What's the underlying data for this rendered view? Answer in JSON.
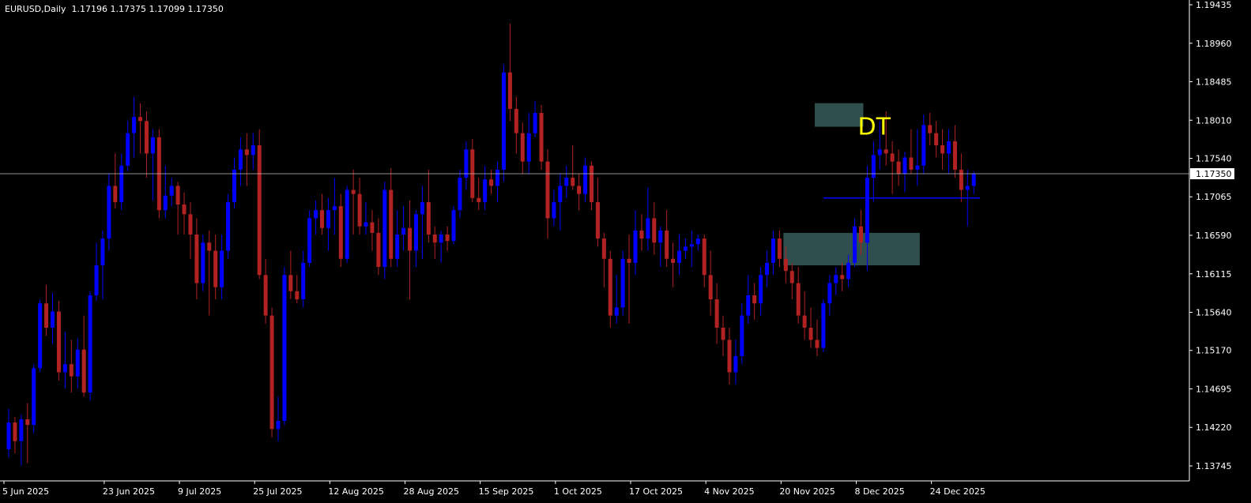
{
  "chart_header": {
    "symbol": "EURUSD,Daily",
    "ohlc": "1.17196 1.17375 1.17099 1.17350"
  },
  "colors": {
    "background": "#000000",
    "axis": "#ffffff",
    "bull": "#0000ff",
    "bear": "#b22222",
    "zone": "#2f4f4f",
    "annotation": "#ffff00",
    "price_line": "#c0c0c0"
  },
  "chart_data": {
    "type": "candlestick",
    "title": "EURUSD,Daily",
    "current_price": 1.1735,
    "current_price_label": "1.17350",
    "ylim": [
      1.1347,
      1.1952
    ],
    "y_ticks": [
      "1.19435",
      "1.18960",
      "1.18485",
      "1.18010",
      "1.17540",
      "1.17065",
      "1.16590",
      "1.16115",
      "1.15640",
      "1.15170",
      "1.14695",
      "1.14220",
      "1.13745"
    ],
    "x_tick_labels": [
      {
        "label": "5 Jun 2025",
        "index": 0
      },
      {
        "label": "23 Jun 2025",
        "index": 16
      },
      {
        "label": "9 Jul 2025",
        "index": 28
      },
      {
        "label": "25 Jul 2025",
        "index": 40
      },
      {
        "label": "12 Aug 2025",
        "index": 52
      },
      {
        "label": "28 Aug 2025",
        "index": 64
      },
      {
        "label": "15 Sep 2025",
        "index": 76
      },
      {
        "label": "1 Oct 2025",
        "index": 88
      },
      {
        "label": "17 Oct 2025",
        "index": 100
      },
      {
        "label": "4 Nov 2025",
        "index": 112
      },
      {
        "label": "20 Nov 2025",
        "index": 124
      },
      {
        "label": "8 Dec 2025",
        "index": 136
      },
      {
        "label": "24 Dec 2025",
        "index": 148
      }
    ],
    "candles": [
      [
        1.1395,
        1.1445,
        1.1385,
        1.1428
      ],
      [
        1.1428,
        1.1435,
        1.139,
        1.1405
      ],
      [
        1.1405,
        1.1438,
        1.1375,
        1.1432
      ],
      [
        1.1432,
        1.1452,
        1.1378,
        1.1425
      ],
      [
        1.1425,
        1.15,
        1.1415,
        1.1495
      ],
      [
        1.1495,
        1.158,
        1.149,
        1.1575
      ],
      [
        1.1575,
        1.1598,
        1.1535,
        1.1545
      ],
      [
        1.1545,
        1.1588,
        1.1525,
        1.1565
      ],
      [
        1.1565,
        1.1578,
        1.148,
        1.149
      ],
      [
        1.149,
        1.154,
        1.147,
        1.15
      ],
      [
        1.15,
        1.153,
        1.1465,
        1.1485
      ],
      [
        1.1485,
        1.1532,
        1.147,
        1.1518
      ],
      [
        1.1518,
        1.156,
        1.146,
        1.1465
      ],
      [
        1.1465,
        1.159,
        1.1455,
        1.1585
      ],
      [
        1.1585,
        1.165,
        1.1578,
        1.1622
      ],
      [
        1.1622,
        1.1665,
        1.158,
        1.1655
      ],
      [
        1.1655,
        1.1735,
        1.164,
        1.172
      ],
      [
        1.172,
        1.176,
        1.1692,
        1.17
      ],
      [
        1.17,
        1.176,
        1.169,
        1.1745
      ],
      [
        1.1745,
        1.18,
        1.1738,
        1.1785
      ],
      [
        1.1785,
        1.183,
        1.1755,
        1.1805
      ],
      [
        1.1805,
        1.1822,
        1.176,
        1.18
      ],
      [
        1.18,
        1.1812,
        1.173,
        1.176
      ],
      [
        1.176,
        1.179,
        1.1702,
        1.178
      ],
      [
        1.178,
        1.179,
        1.168,
        1.169
      ],
      [
        1.169,
        1.1745,
        1.168,
        1.1708
      ],
      [
        1.1708,
        1.173,
        1.1695,
        1.172
      ],
      [
        1.172,
        1.1725,
        1.166,
        1.1697
      ],
      [
        1.1697,
        1.1712,
        1.166,
        1.1685
      ],
      [
        1.1685,
        1.17,
        1.163,
        1.166
      ],
      [
        1.166,
        1.168,
        1.158,
        1.16
      ],
      [
        1.16,
        1.166,
        1.159,
        1.165
      ],
      [
        1.165,
        1.1665,
        1.156,
        1.164
      ],
      [
        1.164,
        1.166,
        1.158,
        1.1595
      ],
      [
        1.1595,
        1.166,
        1.158,
        1.164
      ],
      [
        1.164,
        1.171,
        1.163,
        1.17
      ],
      [
        1.17,
        1.1755,
        1.1692,
        1.174
      ],
      [
        1.174,
        1.178,
        1.172,
        1.1765
      ],
      [
        1.1765,
        1.1785,
        1.172,
        1.1758
      ],
      [
        1.1758,
        1.1785,
        1.174,
        1.177
      ],
      [
        1.177,
        1.179,
        1.1605,
        1.161
      ],
      [
        1.161,
        1.163,
        1.155,
        1.156
      ],
      [
        1.156,
        1.157,
        1.141,
        1.142
      ],
      [
        1.142,
        1.146,
        1.1405,
        1.143
      ],
      [
        1.143,
        1.162,
        1.1425,
        1.161
      ],
      [
        1.161,
        1.164,
        1.158,
        1.159
      ],
      [
        1.159,
        1.161,
        1.1575,
        1.158
      ],
      [
        1.158,
        1.164,
        1.157,
        1.1625
      ],
      [
        1.1625,
        1.169,
        1.162,
        1.168
      ],
      [
        1.168,
        1.1702,
        1.166,
        1.169
      ],
      [
        1.169,
        1.171,
        1.166,
        1.1668
      ],
      [
        1.1668,
        1.1705,
        1.164,
        1.169
      ],
      [
        1.169,
        1.173,
        1.166,
        1.1695
      ],
      [
        1.1695,
        1.171,
        1.162,
        1.163
      ],
      [
        1.163,
        1.172,
        1.1625,
        1.1715
      ],
      [
        1.1715,
        1.174,
        1.166,
        1.171
      ],
      [
        1.171,
        1.173,
        1.166,
        1.167
      ],
      [
        1.167,
        1.17,
        1.166,
        1.1675
      ],
      [
        1.1675,
        1.169,
        1.164,
        1.1662
      ],
      [
        1.1662,
        1.168,
        1.161,
        1.162
      ],
      [
        1.162,
        1.1725,
        1.1605,
        1.1715
      ],
      [
        1.1715,
        1.1742,
        1.162,
        1.163
      ],
      [
        1.163,
        1.169,
        1.162,
        1.166
      ],
      [
        1.166,
        1.1695,
        1.164,
        1.1668
      ],
      [
        1.1668,
        1.1702,
        1.158,
        1.164
      ],
      [
        1.164,
        1.169,
        1.162,
        1.1685
      ],
      [
        1.1685,
        1.172,
        1.163,
        1.17
      ],
      [
        1.17,
        1.174,
        1.165,
        1.166
      ],
      [
        1.166,
        1.167,
        1.163,
        1.165
      ],
      [
        1.165,
        1.1665,
        1.1625,
        1.166
      ],
      [
        1.166,
        1.167,
        1.164,
        1.1652
      ],
      [
        1.1652,
        1.1695,
        1.1648,
        1.169
      ],
      [
        1.169,
        1.174,
        1.168,
        1.173
      ],
      [
        1.173,
        1.1775,
        1.1715,
        1.1765
      ],
      [
        1.1765,
        1.1778,
        1.17,
        1.1705
      ],
      [
        1.1705,
        1.173,
        1.169,
        1.17
      ],
      [
        1.17,
        1.1745,
        1.169,
        1.1728
      ],
      [
        1.1728,
        1.174,
        1.171,
        1.172
      ],
      [
        1.172,
        1.175,
        1.17,
        1.174
      ],
      [
        1.174,
        1.187,
        1.1725,
        1.186
      ],
      [
        1.186,
        1.192,
        1.18,
        1.1815
      ],
      [
        1.1815,
        1.183,
        1.176,
        1.1785
      ],
      [
        1.1785,
        1.1798,
        1.1735,
        1.175
      ],
      [
        1.175,
        1.181,
        1.1735,
        1.1785
      ],
      [
        1.1785,
        1.1825,
        1.178,
        1.181
      ],
      [
        1.181,
        1.182,
        1.174,
        1.175
      ],
      [
        1.175,
        1.1765,
        1.1655,
        1.168
      ],
      [
        1.168,
        1.1715,
        1.167,
        1.17
      ],
      [
        1.17,
        1.1735,
        1.1665,
        1.172
      ],
      [
        1.172,
        1.1745,
        1.1705,
        1.173
      ],
      [
        1.173,
        1.177,
        1.1715,
        1.172
      ],
      [
        1.172,
        1.1735,
        1.169,
        1.171
      ],
      [
        1.171,
        1.1755,
        1.17,
        1.1745
      ],
      [
        1.1745,
        1.175,
        1.169,
        1.17
      ],
      [
        1.17,
        1.173,
        1.1645,
        1.1655
      ],
      [
        1.1655,
        1.1662,
        1.1595,
        1.163
      ],
      [
        1.163,
        1.164,
        1.1545,
        1.156
      ],
      [
        1.156,
        1.161,
        1.155,
        1.157
      ],
      [
        1.157,
        1.164,
        1.156,
        1.163
      ],
      [
        1.163,
        1.166,
        1.155,
        1.1625
      ],
      [
        1.1625,
        1.169,
        1.161,
        1.1665
      ],
      [
        1.1665,
        1.1685,
        1.164,
        1.1655
      ],
      [
        1.1655,
        1.1718,
        1.164,
        1.168
      ],
      [
        1.168,
        1.17,
        1.1635,
        1.165
      ],
      [
        1.165,
        1.167,
        1.162,
        1.1665
      ],
      [
        1.1665,
        1.169,
        1.162,
        1.163
      ],
      [
        1.163,
        1.165,
        1.1595,
        1.1625
      ],
      [
        1.1625,
        1.166,
        1.161,
        1.164
      ],
      [
        1.164,
        1.1655,
        1.163,
        1.1645
      ],
      [
        1.1645,
        1.1665,
        1.162,
        1.1648
      ],
      [
        1.1648,
        1.166,
        1.164,
        1.1655
      ],
      [
        1.1655,
        1.166,
        1.1595,
        1.161
      ],
      [
        1.161,
        1.164,
        1.156,
        1.158
      ],
      [
        1.158,
        1.16,
        1.1525,
        1.1545
      ],
      [
        1.1545,
        1.156,
        1.151,
        1.153
      ],
      [
        1.153,
        1.1545,
        1.1475,
        1.149
      ],
      [
        1.149,
        1.153,
        1.1475,
        1.151
      ],
      [
        1.151,
        1.1575,
        1.15,
        1.156
      ],
      [
        1.156,
        1.161,
        1.155,
        1.1585
      ],
      [
        1.1585,
        1.16,
        1.1555,
        1.1575
      ],
      [
        1.1575,
        1.162,
        1.156,
        1.161
      ],
      [
        1.161,
        1.164,
        1.1595,
        1.1625
      ],
      [
        1.1625,
        1.1665,
        1.161,
        1.1655
      ],
      [
        1.1655,
        1.1665,
        1.162,
        1.163
      ],
      [
        1.163,
        1.1645,
        1.16,
        1.1615
      ],
      [
        1.1615,
        1.1625,
        1.158,
        1.16
      ],
      [
        1.16,
        1.162,
        1.155,
        1.156
      ],
      [
        1.156,
        1.159,
        1.153,
        1.1545
      ],
      [
        1.1545,
        1.157,
        1.152,
        1.153
      ],
      [
        1.153,
        1.1555,
        1.151,
        1.152
      ],
      [
        1.152,
        1.158,
        1.1515,
        1.1575
      ],
      [
        1.1575,
        1.161,
        1.156,
        1.16
      ],
      [
        1.16,
        1.162,
        1.1585,
        1.161
      ],
      [
        1.161,
        1.1625,
        1.159,
        1.1605
      ],
      [
        1.1605,
        1.1635,
        1.1595,
        1.1625
      ],
      [
        1.1625,
        1.168,
        1.162,
        1.167
      ],
      [
        1.167,
        1.169,
        1.1635,
        1.165
      ],
      [
        1.165,
        1.1745,
        1.1615,
        1.173
      ],
      [
        1.173,
        1.1775,
        1.17,
        1.1758
      ],
      [
        1.1758,
        1.18,
        1.174,
        1.1765
      ],
      [
        1.1765,
        1.1812,
        1.1745,
        1.176
      ],
      [
        1.176,
        1.1775,
        1.171,
        1.175
      ],
      [
        1.175,
        1.1765,
        1.172,
        1.1735
      ],
      [
        1.1735,
        1.1762,
        1.1712,
        1.1755
      ],
      [
        1.1755,
        1.179,
        1.1735,
        1.174
      ],
      [
        1.174,
        1.179,
        1.172,
        1.1745
      ],
      [
        1.1745,
        1.1808,
        1.1735,
        1.1795
      ],
      [
        1.1795,
        1.181,
        1.177,
        1.1785
      ],
      [
        1.1785,
        1.18,
        1.1755,
        1.177
      ],
      [
        1.177,
        1.179,
        1.174,
        1.176
      ],
      [
        1.176,
        1.179,
        1.1735,
        1.1775
      ],
      [
        1.1775,
        1.1795,
        1.173,
        1.174
      ],
      [
        1.174,
        1.176,
        1.17,
        1.1715
      ],
      [
        1.1715,
        1.174,
        1.167,
        1.172
      ],
      [
        1.172,
        1.1738,
        1.171,
        1.1735
      ]
    ],
    "annotations": {
      "label": "DT",
      "resistance_zone": {
        "x_start_index": 129,
        "x_end_index": 136,
        "y_top": 1.1822,
        "y_bottom": 1.1793
      },
      "support_zone": {
        "x_start_index": 124,
        "x_end_index": 145,
        "y_top": 1.1662,
        "y_bottom": 1.1622
      },
      "neckline": {
        "x_start_index": 130,
        "x_end_index": 155,
        "price": 1.1705
      }
    }
  }
}
